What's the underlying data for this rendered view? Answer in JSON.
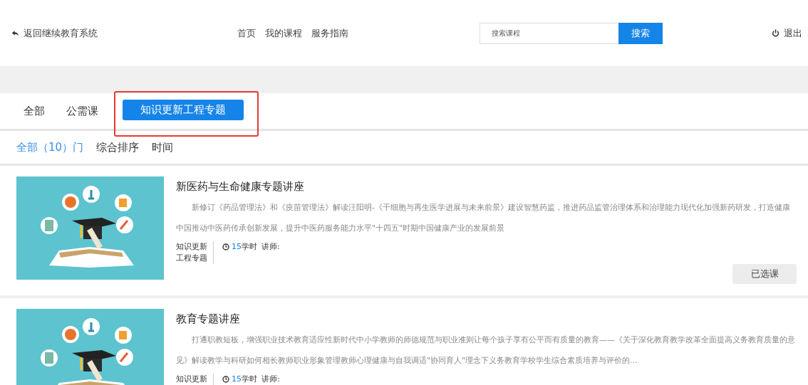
{
  "header": {
    "back_link": "返回继续教育系统",
    "nav": [
      "首页",
      "我的课程",
      "服务指南"
    ],
    "search": {
      "placeholder": "搜索课程",
      "button": "搜索"
    },
    "logout": "退出"
  },
  "tabs": [
    {
      "label": "全部",
      "selected": false,
      "highlighted": false
    },
    {
      "label": "公需课",
      "selected": false,
      "highlighted": false
    },
    {
      "label": "知识更新工程专题",
      "selected": true,
      "highlighted": true
    }
  ],
  "filters": [
    {
      "label": "全部（10）门",
      "selected": true
    },
    {
      "label": "综合排序",
      "selected": false
    },
    {
      "label": "时间",
      "selected": false
    }
  ],
  "courses": [
    {
      "title": "新医药与生命健康专题讲座",
      "description": "新修订《药品管理法》和《疫苗管理法》解读汪阳明-《干细胞与再生医学进展与未来前景》建设智慧药监，推进药品监管治理体系和治理能力现代化加强新药研发，打造健康中国推动中医药传承创新发展，提升中医药服务能力水平\"十四五\"时期中国健康产业的发展前景",
      "tag_lines": [
        "知识更新",
        "工程专题"
      ],
      "hours": "15",
      "hours_unit": "学时",
      "teacher_label": "讲师:",
      "button": "已选课"
    },
    {
      "title": "教育专题讲座",
      "description": "打通职教短板，增强职业技术教育适应性新时代中小学教师的师德规范与职业准则让每个孩子享有公平而有质量的教育——《关于深化教育教学改革全面提高义务教育质量的意见》解读教学与科研如何相长教师职业形象管理教师心理健康与自我调适\"协同育人\"理念下义务教育学校学生综合素质培养与评价的...",
      "tag_lines": [
        "知识更新"
      ],
      "hours": "15",
      "hours_unit": "学时",
      "teacher_label": "讲师:"
    }
  ]
}
